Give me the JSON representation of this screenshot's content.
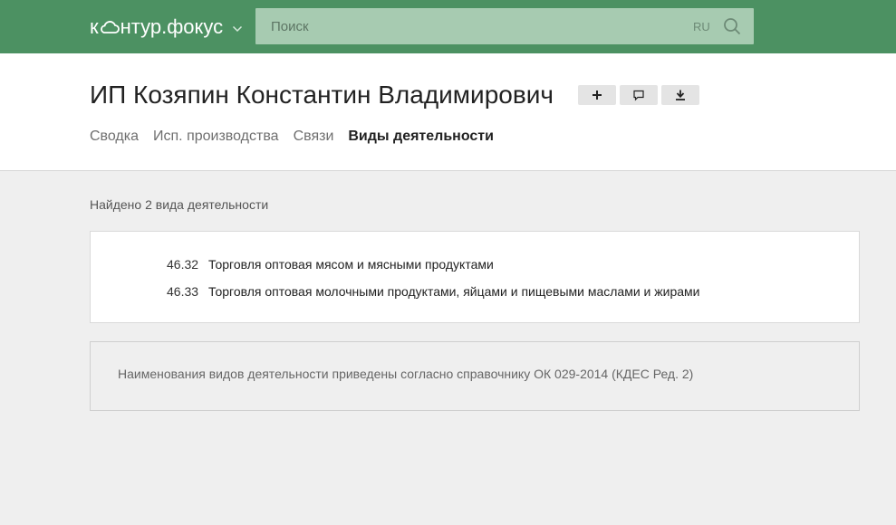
{
  "topbar": {
    "logo_left": "к",
    "logo_right": "нтур.фокус",
    "search_placeholder": "Поиск",
    "lang": "RU",
    "bg_color": "#4c9162"
  },
  "company": {
    "title": "ИП Козяпин Константин Владимирович",
    "actions": [
      {
        "icon": "plus-icon"
      },
      {
        "icon": "comment-icon"
      },
      {
        "icon": "download-icon"
      }
    ]
  },
  "tabs": [
    {
      "label": "Сводка",
      "active": false
    },
    {
      "label": "Исп. производства",
      "active": false
    },
    {
      "label": "Связи",
      "active": false
    },
    {
      "label": "Виды деятельности",
      "active": true
    }
  ],
  "activities": {
    "found_text": "Найдено 2 вида деятельности",
    "items": [
      {
        "code": "46.32",
        "name": "Торговля оптовая мясом и мясными продуктами"
      },
      {
        "code": "46.33",
        "name": "Торговля оптовая молочными продуктами, яйцами и пищевыми маслами и жирами"
      }
    ],
    "note": "Наименования видов деятельности приведены согласно справочнику ОК 029-2014 (КДЕС Ред. 2)"
  }
}
